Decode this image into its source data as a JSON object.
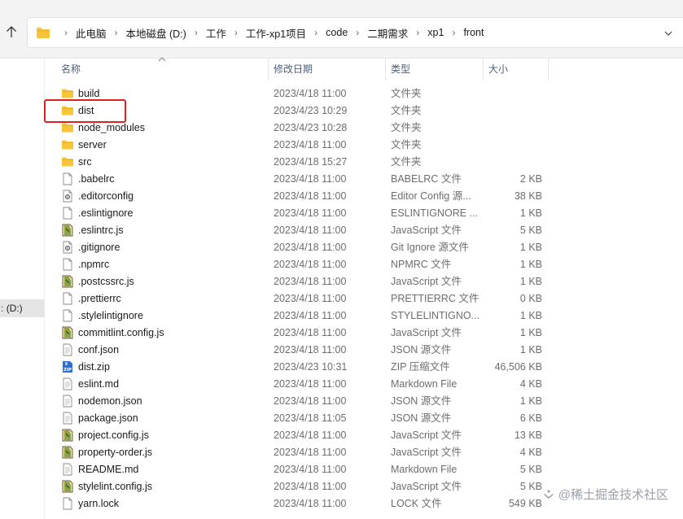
{
  "address": {
    "crumbs": [
      "此电脑",
      "本地磁盘 (D:)",
      "工作",
      "工作-xp1项目",
      "code",
      "二期需求",
      "xp1",
      "front"
    ]
  },
  "nav": {
    "drive_label": "(D:)"
  },
  "columns": {
    "name": "名称",
    "date": "修改日期",
    "type": "类型",
    "size": "大小"
  },
  "files": [
    {
      "icon": "folder-icon",
      "name": "build",
      "date": "2023/4/18 11:00",
      "type": "文件夹",
      "size": ""
    },
    {
      "icon": "folder-icon",
      "name": "dist",
      "date": "2023/4/23 10:29",
      "type": "文件夹",
      "size": ""
    },
    {
      "icon": "folder-icon",
      "name": "node_modules",
      "date": "2023/4/23 10:28",
      "type": "文件夹",
      "size": ""
    },
    {
      "icon": "folder-icon",
      "name": "server",
      "date": "2023/4/18 11:00",
      "type": "文件夹",
      "size": ""
    },
    {
      "icon": "folder-icon",
      "name": "src",
      "date": "2023/4/18 15:27",
      "type": "文件夹",
      "size": ""
    },
    {
      "icon": "blank-file-icon",
      "name": ".babelrc",
      "date": "2023/4/18 11:00",
      "type": "BABELRC 文件",
      "size": "2 KB"
    },
    {
      "icon": "config-file-icon",
      "name": ".editorconfig",
      "date": "2023/4/18 11:00",
      "type": "Editor Config 源...",
      "size": "38 KB"
    },
    {
      "icon": "blank-file-icon",
      "name": ".eslintignore",
      "date": "2023/4/18 11:00",
      "type": "ESLINTIGNORE ...",
      "size": "1 KB"
    },
    {
      "icon": "js-file-icon",
      "name": ".eslintrc.js",
      "date": "2023/4/18 11:00",
      "type": "JavaScript 文件",
      "size": "5 KB"
    },
    {
      "icon": "config-file-icon",
      "name": ".gitignore",
      "date": "2023/4/18 11:00",
      "type": "Git Ignore 源文件",
      "size": "1 KB"
    },
    {
      "icon": "blank-file-icon",
      "name": ".npmrc",
      "date": "2023/4/18 11:00",
      "type": "NPMRC 文件",
      "size": "1 KB"
    },
    {
      "icon": "js-file-icon",
      "name": ".postcssrc.js",
      "date": "2023/4/18 11:00",
      "type": "JavaScript 文件",
      "size": "1 KB"
    },
    {
      "icon": "blank-file-icon",
      "name": ".prettierrc",
      "date": "2023/4/18 11:00",
      "type": "PRETTIERRC 文件",
      "size": "0 KB"
    },
    {
      "icon": "blank-file-icon",
      "name": ".stylelintignore",
      "date": "2023/4/18 11:00",
      "type": "STYLELINTIGNO...",
      "size": "1 KB"
    },
    {
      "icon": "js-file-icon",
      "name": "commitlint.config.js",
      "date": "2023/4/18 11:00",
      "type": "JavaScript 文件",
      "size": "1 KB"
    },
    {
      "icon": "text-file-icon",
      "name": "conf.json",
      "date": "2023/4/18 11:00",
      "type": "JSON 源文件",
      "size": "1 KB"
    },
    {
      "icon": "zip-file-icon",
      "name": "dist.zip",
      "date": "2023/4/23 10:31",
      "type": "ZIP 压缩文件",
      "size": "46,506 KB"
    },
    {
      "icon": "text-file-icon",
      "name": "eslint.md",
      "date": "2023/4/18 11:00",
      "type": "Markdown File",
      "size": "4 KB"
    },
    {
      "icon": "text-file-icon",
      "name": "nodemon.json",
      "date": "2023/4/18 11:00",
      "type": "JSON 源文件",
      "size": "1 KB"
    },
    {
      "icon": "text-file-icon",
      "name": "package.json",
      "date": "2023/4/18 11:05",
      "type": "JSON 源文件",
      "size": "6 KB"
    },
    {
      "icon": "js-file-icon",
      "name": "project.config.js",
      "date": "2023/4/18 11:00",
      "type": "JavaScript 文件",
      "size": "13 KB"
    },
    {
      "icon": "js-file-icon",
      "name": "property-order.js",
      "date": "2023/4/18 11:00",
      "type": "JavaScript 文件",
      "size": "4 KB"
    },
    {
      "icon": "text-file-icon",
      "name": "README.md",
      "date": "2023/4/18 11:00",
      "type": "Markdown File",
      "size": "5 KB"
    },
    {
      "icon": "js-file-icon",
      "name": "stylelint.config.js",
      "date": "2023/4/18 11:00",
      "type": "JavaScript 文件",
      "size": "5 KB"
    },
    {
      "icon": "blank-file-icon",
      "name": "yarn.lock",
      "date": "2023/4/18 11:00",
      "type": "LOCK 文件",
      "size": "549 KB"
    }
  ],
  "watermark": {
    "text": "@稀土掘金技术社区"
  },
  "colors": {
    "folder": "#f8c53a",
    "highlight": "#e02020",
    "header_text": "#4c607a"
  }
}
